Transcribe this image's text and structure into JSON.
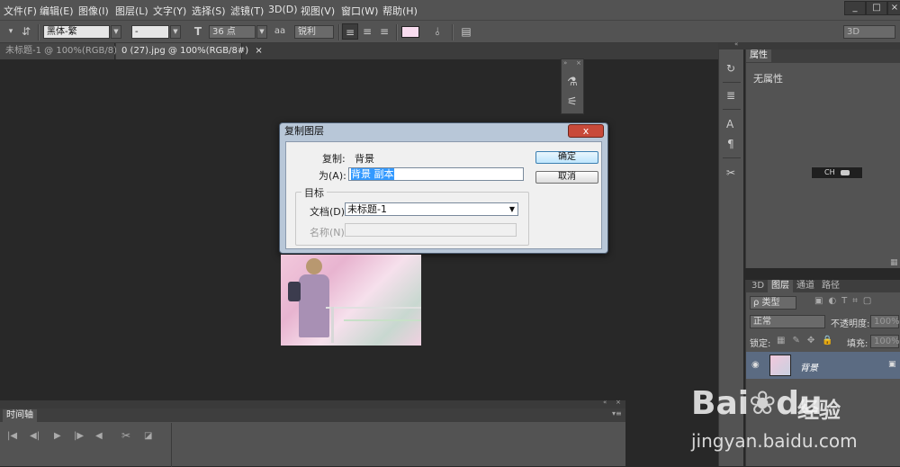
{
  "menu": [
    "文件(F)",
    "编辑(E)",
    "图像(I)",
    "图层(L)",
    "文字(Y)",
    "选择(S)",
    "滤镜(T)",
    "3D(D)",
    "视图(V)",
    "窗口(W)",
    "帮助(H)"
  ],
  "window_controls": [
    "_",
    "□",
    "×"
  ],
  "options": {
    "font_family": "黑体-繁",
    "font_style": "-",
    "font_size": "36 点",
    "antialias_icon": "aa",
    "antialias": "锐利",
    "workspace": "3D"
  },
  "tabs": [
    {
      "label": "未标题-1 @ 100%(RGB/8)",
      "close": "×"
    },
    {
      "label": "0 (27).jpg @ 100%(RGB/8#)",
      "close": "×"
    }
  ],
  "dialog": {
    "title": "复制图层",
    "close": "x",
    "copy_label": "复制:",
    "copy_value": "背景",
    "as_label": "为(A):",
    "as_value": "背景 副本",
    "target_label": "目标",
    "doc_label": "文档(D):",
    "doc_value": "未标题-1",
    "name_label": "名称(N):",
    "name_value": "",
    "ok": "确定",
    "cancel": "取消"
  },
  "properties": {
    "tab": "属性",
    "text": "无属性",
    "ch_label": "CH"
  },
  "layers": {
    "tabs": [
      "3D",
      "图层",
      "通道",
      "路径"
    ],
    "filter_label": "ρ 类型",
    "blend_mode": "正常",
    "opacity_label": "不透明度:",
    "opacity_value": "100%",
    "lock_label": "锁定:",
    "fill_label": "填充:",
    "fill_value": "100%",
    "layer_name": "背景"
  },
  "timeline": {
    "title": "时间轴"
  },
  "watermark": {
    "brand": "Bai",
    "brand2": "du",
    "cn": "经验",
    "url": "jingyan.baidu.com"
  },
  "colors": {
    "accent_blue": "#3399ff",
    "panel": "#535353",
    "canvas": "#282828"
  }
}
